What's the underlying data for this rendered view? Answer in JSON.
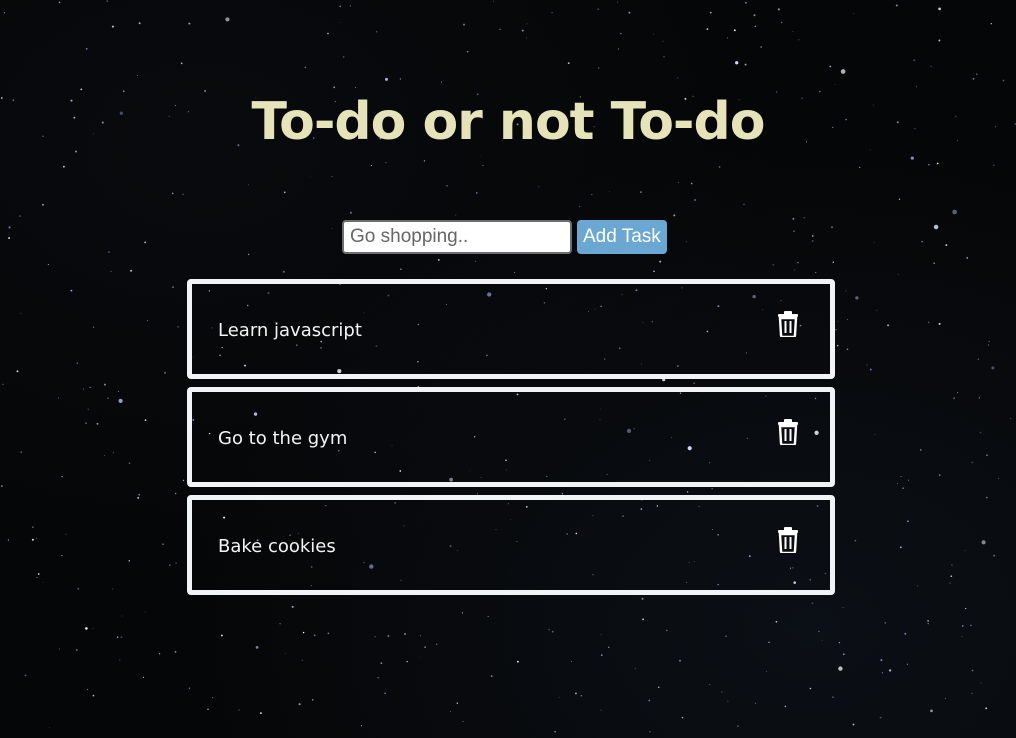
{
  "app": {
    "title": "To-do or not To-do"
  },
  "form": {
    "placeholder": "Go shopping..",
    "value": "",
    "add_label": "Add Task"
  },
  "tasks": [
    {
      "text": "Learn javascript"
    },
    {
      "text": "Go to the gym"
    },
    {
      "text": "Bake cookies"
    }
  ],
  "colors": {
    "title": "#e6e3b8",
    "button": "#6aa7d3",
    "card_border": "#f1f4f7",
    "background": "#050607"
  },
  "icons": {
    "delete": "trash-icon"
  }
}
